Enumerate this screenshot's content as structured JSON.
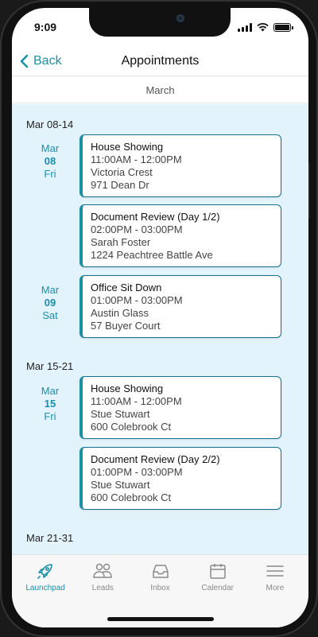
{
  "status": {
    "time": "9:09"
  },
  "nav": {
    "back_label": "Back",
    "title": "Appointments"
  },
  "month": "March",
  "weeks": [
    {
      "label": "Mar 08-14"
    },
    {
      "label": "Mar 15-21"
    },
    {
      "label": "Mar 21-31"
    }
  ],
  "days": [
    {
      "month": "Mar",
      "num": "08",
      "dow": "Fri"
    },
    {
      "month": "Mar",
      "num": "09",
      "dow": "Sat"
    },
    {
      "month": "Mar",
      "num": "15",
      "dow": "Fri"
    }
  ],
  "appointments": [
    {
      "title": "House Showing",
      "time": "11:00AM - 12:00PM",
      "person": "Victoria Crest",
      "address": "971 Dean Dr"
    },
    {
      "title": "Document Review (Day 1/2)",
      "time": "02:00PM - 03:00PM",
      "person": "Sarah Foster",
      "address": "1224 Peachtree Battle Ave"
    },
    {
      "title": "Office Sit Down",
      "time": "01:00PM - 03:00PM",
      "person": "Austin Glass",
      "address": "57 Buyer Court"
    },
    {
      "title": "House Showing",
      "time": "11:00AM - 12:00PM",
      "person": "Stue Stuwart",
      "address": "600 Colebrook Ct"
    },
    {
      "title": "Document Review (Day 2/2)",
      "time": "01:00PM - 03:00PM",
      "person": "Stue Stuwart",
      "address": "600 Colebrook Ct"
    }
  ],
  "tabs": [
    {
      "label": "Launchpad",
      "icon": "rocket-icon"
    },
    {
      "label": "Leads",
      "icon": "people-icon"
    },
    {
      "label": "Inbox",
      "icon": "inbox-icon"
    },
    {
      "label": "Calendar",
      "icon": "calendar-icon"
    },
    {
      "label": "More",
      "icon": "menu-icon"
    }
  ],
  "colors": {
    "accent": "#1a8fa8",
    "content_bg": "#e3f3fb",
    "tab_inactive": "#8a8a8a"
  }
}
